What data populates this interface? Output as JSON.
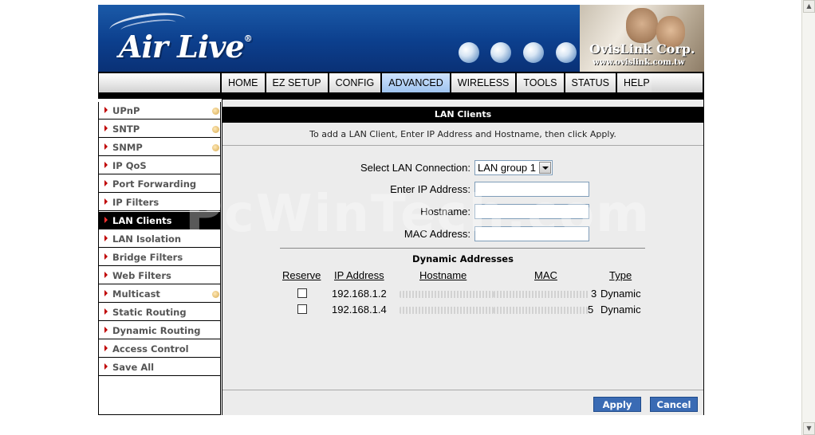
{
  "banner": {
    "logo_text": "Air Live",
    "logo_mark": "®",
    "corp_name": "OvisLink Corp.",
    "corp_url": "www.ovislink.com.tw",
    "globes": [
      "globe-icon",
      "globe-icon",
      "globe-icon",
      "globe-icon"
    ]
  },
  "nav": {
    "items": [
      "HOME",
      "EZ SETUP",
      "CONFIG",
      "ADVANCED",
      "WIRELESS",
      "TOOLS",
      "STATUS",
      "HELP"
    ],
    "active": "ADVANCED"
  },
  "sidebar": {
    "items": [
      {
        "label": "UPnP",
        "has_dot": true
      },
      {
        "label": "SNTP",
        "has_dot": true
      },
      {
        "label": "SNMP",
        "has_dot": true
      },
      {
        "label": "IP QoS",
        "has_dot": false
      },
      {
        "label": "Port Forwarding",
        "has_dot": false
      },
      {
        "label": "IP Filters",
        "has_dot": false
      },
      {
        "label": "LAN Clients",
        "has_dot": false,
        "active": true
      },
      {
        "label": "LAN Isolation",
        "has_dot": false
      },
      {
        "label": "Bridge Filters",
        "has_dot": false
      },
      {
        "label": "Web Filters",
        "has_dot": false
      },
      {
        "label": "Multicast",
        "has_dot": true
      },
      {
        "label": "Static Routing",
        "has_dot": false
      },
      {
        "label": "Dynamic Routing",
        "has_dot": false
      },
      {
        "label": "Access Control",
        "has_dot": false
      },
      {
        "label": "Save All",
        "has_dot": false
      }
    ]
  },
  "main": {
    "title": "LAN Clients",
    "intro": "To add a LAN Client, Enter IP Address and Hostname, then click Apply.",
    "form": {
      "select_label": "Select LAN Connection:",
      "select_value": "LAN group 1",
      "ip_label": "Enter IP Address:",
      "ip_value": "",
      "hostname_label": "Hostname:",
      "hostname_value": "",
      "mac_label": "MAC Address:",
      "mac_value": ""
    },
    "dynamic": {
      "title": "Dynamic Addresses",
      "headers": {
        "reserve": "Reserve",
        "ip": "IP Address",
        "hostname": "Hostname",
        "mac": "MAC",
        "type": "Type"
      },
      "rows": [
        {
          "ip": "192.168.1.2",
          "mac_tail": "3",
          "type": "Dynamic"
        },
        {
          "ip": "192.168.1.4",
          "mac_tail": "5",
          "type": "Dynamic"
        }
      ]
    },
    "buttons": {
      "apply": "Apply",
      "cancel": "Cancel"
    }
  },
  "watermark": "PcWinTech.com",
  "colors": {
    "banner_blue": "#0c3f8d",
    "nav_active": "#9fc4ef",
    "button_blue": "#3a6bb4",
    "menu_marker": "#c00000",
    "panel_bg": "#ececec"
  }
}
